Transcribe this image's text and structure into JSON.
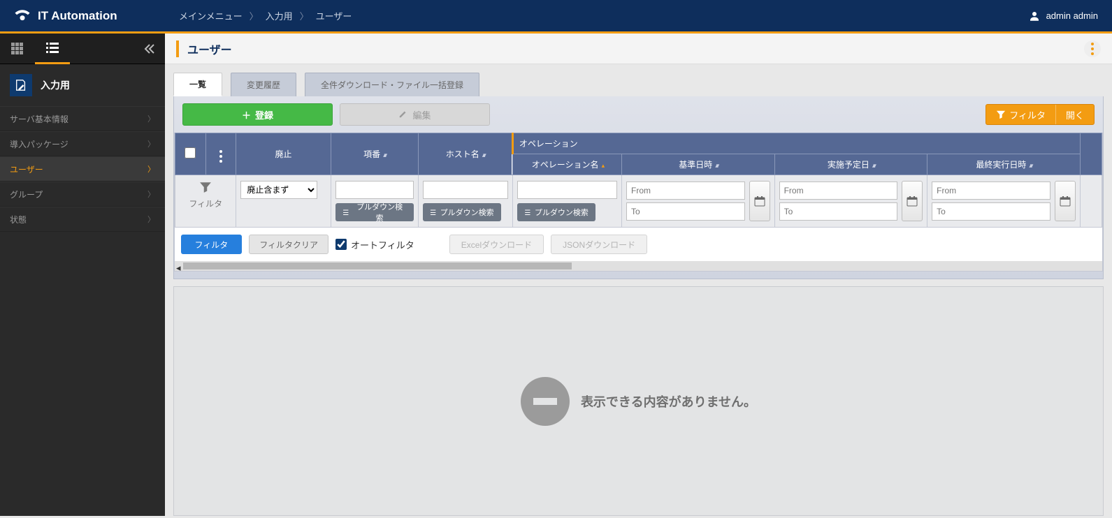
{
  "header": {
    "product": "IT Automation",
    "breadcrumb": [
      "メインメニュー",
      "入力用",
      "ユーザー"
    ],
    "user": "admin admin"
  },
  "sidebar": {
    "section": "入力用",
    "items": [
      {
        "label": "サーバ基本情報",
        "active": false
      },
      {
        "label": "導入パッケージ",
        "active": false
      },
      {
        "label": "ユーザー",
        "active": true
      },
      {
        "label": "グループ",
        "active": false
      },
      {
        "label": "状態",
        "active": false
      }
    ]
  },
  "page": {
    "title": "ユーザー",
    "tabs": [
      {
        "label": "一覧",
        "active": true
      },
      {
        "label": "変更履歴",
        "active": false
      },
      {
        "label": "全件ダウンロード・ファイル一括登録",
        "active": false
      }
    ],
    "register": "登録",
    "edit": "編集",
    "filter_open": {
      "filter": "フィルタ",
      "open": "開く"
    }
  },
  "columns": {
    "disable": "廃止",
    "item_no": "項番",
    "host": "ホスト名",
    "op_group": "オペレーション",
    "op_name": "オペレーション名",
    "base_date": "基準日時",
    "sched_date": "実施予定日",
    "last_exec": "最終実行日時"
  },
  "filter": {
    "label": "フィルタ",
    "disable_value": "廃止含まず",
    "pulldown": "プルダウン検索",
    "from": "From",
    "to": "To",
    "apply": "フィルタ",
    "clear": "フィルタクリア",
    "auto": "オートフィルタ",
    "excel": "Excelダウンロード",
    "json": "JSONダウンロード"
  },
  "empty": "表示できる内容がありません。"
}
